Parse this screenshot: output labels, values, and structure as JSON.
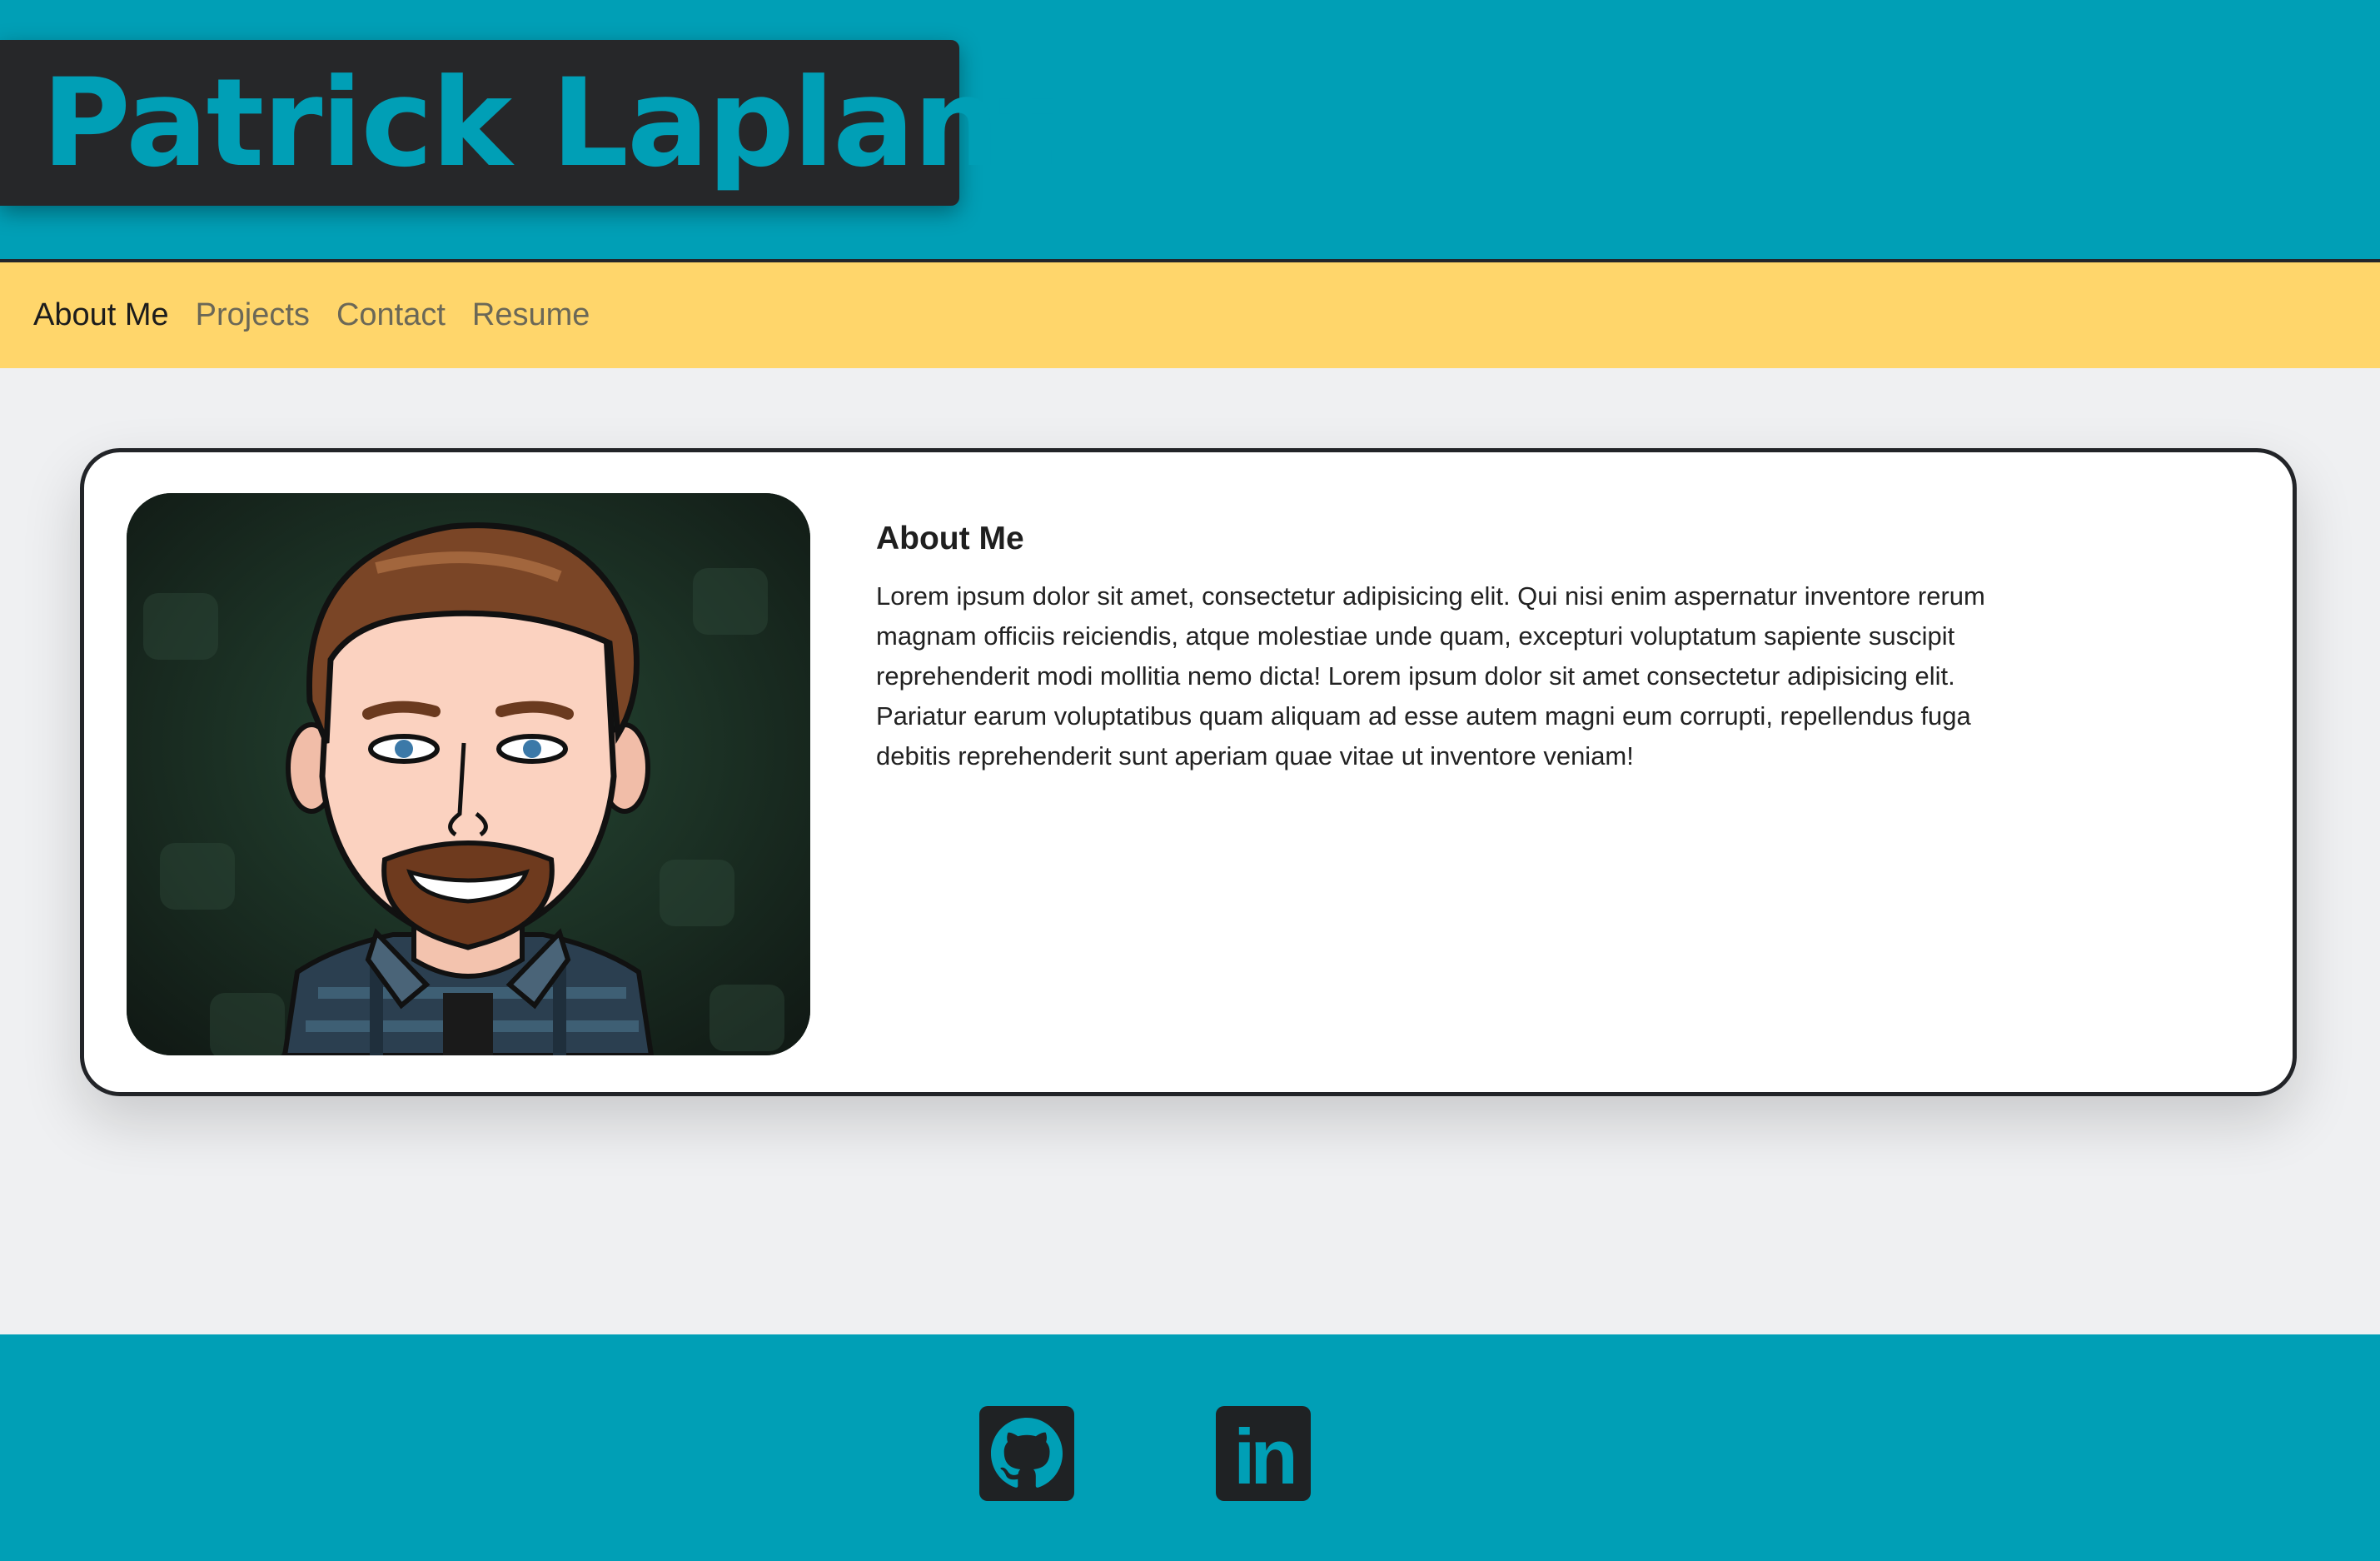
{
  "header": {
    "title": "Patrick Laplante"
  },
  "nav": {
    "items": [
      {
        "label": "About Me",
        "active": true
      },
      {
        "label": "Projects",
        "active": false
      },
      {
        "label": "Contact",
        "active": false
      },
      {
        "label": "Resume",
        "active": false
      }
    ]
  },
  "about": {
    "title": "About Me",
    "text": "Lorem ipsum dolor sit amet, consectetur adipisicing elit. Qui nisi enim aspernatur inventore rerum magnam officiis reiciendis, atque molestiae unde quam, excepturi voluptatum sapiente suscipit reprehenderit modi mollitia nemo dicta! Lorem ipsum dolor sit amet consectetur adipisicing elit. Pariatur earum voluptatibus quam aliquam ad esse autem magni eum corrupti, repellendus fuga debitis reprehenderit sunt aperiam quae vitae ut inventore veniam!",
    "avatar": "bitmoji-avatar"
  },
  "footer": {
    "links": [
      {
        "icon": "github-icon"
      },
      {
        "icon": "linkedin-icon",
        "label": "in"
      }
    ]
  },
  "colors": {
    "header_bg": "#009fb6",
    "title_box_bg": "#262729",
    "nav_bg": "#ffd66b",
    "page_bg": "#eff0f2",
    "card_bg": "#ffffff",
    "footer_bg": "#009fb6"
  }
}
